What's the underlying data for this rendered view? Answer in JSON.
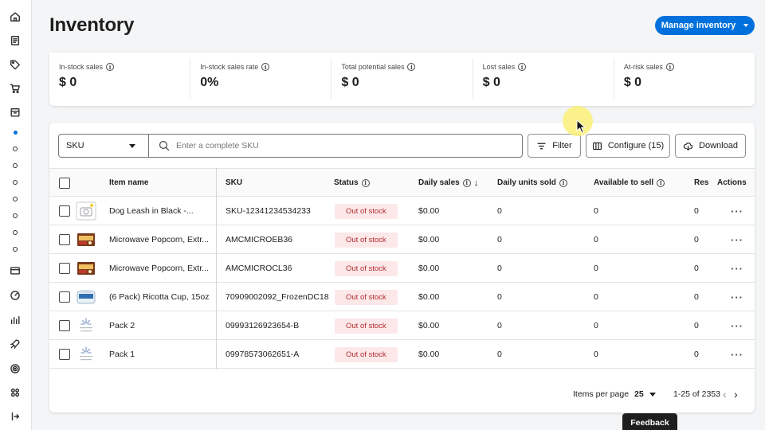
{
  "header": {
    "title": "Inventory",
    "manage_button": "Manage inventory"
  },
  "metrics": [
    {
      "label": "In-stock sales",
      "value": "$ 0"
    },
    {
      "label": "In-stock sales rate",
      "value": "0%"
    },
    {
      "label": "Total potential sales",
      "value": "$ 0"
    },
    {
      "label": "Lost sales",
      "value": "$ 0"
    },
    {
      "label": "At-risk sales",
      "value": "$ 0"
    }
  ],
  "toolbar": {
    "select_value": "SKU",
    "search_placeholder": "Enter a complete SKU",
    "filter_label": "Filter",
    "configure_label": "Configure (15)",
    "download_label": "Download"
  },
  "table": {
    "columns": {
      "item_name": "Item name",
      "sku": "SKU",
      "status": "Status",
      "daily_sales": "Daily sales",
      "daily_units": "Daily units sold",
      "available": "Available to sell",
      "res": "Res",
      "actions": "Actions"
    },
    "rows": [
      {
        "name": "Dog Leash in Black -...",
        "sku": "SKU-12341234534233",
        "status": "Out of stock",
        "daily_sales": "$0.00",
        "daily_units": "0",
        "available": "0",
        "res": "0",
        "thumb": "placeholder-camera"
      },
      {
        "name": "Microwave Popcorn, Extr...",
        "sku": "AMCMICROEB36",
        "status": "Out of stock",
        "daily_sales": "$0.00",
        "daily_units": "0",
        "available": "0",
        "res": "0",
        "thumb": "popcorn-box"
      },
      {
        "name": "Microwave Popcorn, Extr...",
        "sku": "AMCMICROCL36",
        "status": "Out of stock",
        "daily_sales": "$0.00",
        "daily_units": "0",
        "available": "0",
        "res": "0",
        "thumb": "popcorn-box"
      },
      {
        "name": "(6 Pack) Ricotta Cup, 15oz",
        "sku": "70909002092_FrozenDC18",
        "status": "Out of stock",
        "daily_sales": "$0.00",
        "daily_units": "0",
        "available": "0",
        "res": "0",
        "thumb": "ricotta-cup"
      },
      {
        "name": "Pack 2",
        "sku": "09993126923654-B",
        "status": "Out of stock",
        "daily_sales": "$0.00",
        "daily_units": "0",
        "available": "0",
        "res": "0",
        "thumb": "image-coming-soon"
      },
      {
        "name": "Pack 1",
        "sku": "09978573062651-A",
        "status": "Out of stock",
        "daily_sales": "$0.00",
        "daily_units": "0",
        "available": "0",
        "res": "0",
        "thumb": "image-coming-soon"
      }
    ],
    "actions_glyph": "···"
  },
  "pagination": {
    "items_per_page_label": "Items per page",
    "items_per_page_value": "25",
    "range_text": "1-25 of 2353"
  },
  "feedback_label": "Feedback",
  "colors": {
    "primary": "#0071dc",
    "badge_bg": "#fce8e9",
    "badge_text": "#b52b2f"
  }
}
